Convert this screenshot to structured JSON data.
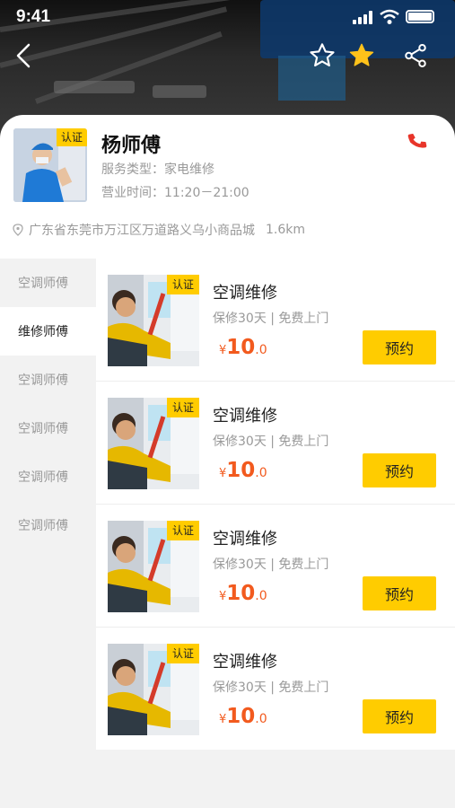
{
  "status_bar": {
    "time": "9:41"
  },
  "profile": {
    "badge": "认证",
    "name": "杨师傅",
    "service_type": "服务类型：家电维修",
    "hours": "营业时间：11:20－21:00",
    "address": "广东省东莞市万江区万道路义乌小商品城",
    "distance": "1.6km"
  },
  "sidebar": {
    "items": [
      {
        "label": "空调师傅"
      },
      {
        "label": "维修师傅"
      },
      {
        "label": "空调师傅"
      },
      {
        "label": "空调师傅"
      },
      {
        "label": "空调师傅"
      },
      {
        "label": "空调师傅"
      }
    ]
  },
  "services": [
    {
      "badge": "认证",
      "title": "空调维修",
      "subtitle": "保修30天 | 免费上门",
      "currency": "¥",
      "price_int": "10",
      "price_dec": ".0",
      "button": "预约"
    },
    {
      "badge": "认证",
      "title": "空调维修",
      "subtitle": "保修30天 | 免费上门",
      "currency": "¥",
      "price_int": "10",
      "price_dec": ".0",
      "button": "预约"
    },
    {
      "badge": "认证",
      "title": "空调维修",
      "subtitle": "保修30天 | 免费上门",
      "currency": "¥",
      "price_int": "10",
      "price_dec": ".0",
      "button": "预约"
    },
    {
      "badge": "认证",
      "title": "空调维修",
      "subtitle": "保修30天 | 免费上门",
      "currency": "¥",
      "price_int": "10",
      "price_dec": ".0",
      "button": "预约"
    }
  ],
  "colors": {
    "accent": "#ffcc00",
    "price": "#f25a1e",
    "phone": "#e8352a"
  }
}
